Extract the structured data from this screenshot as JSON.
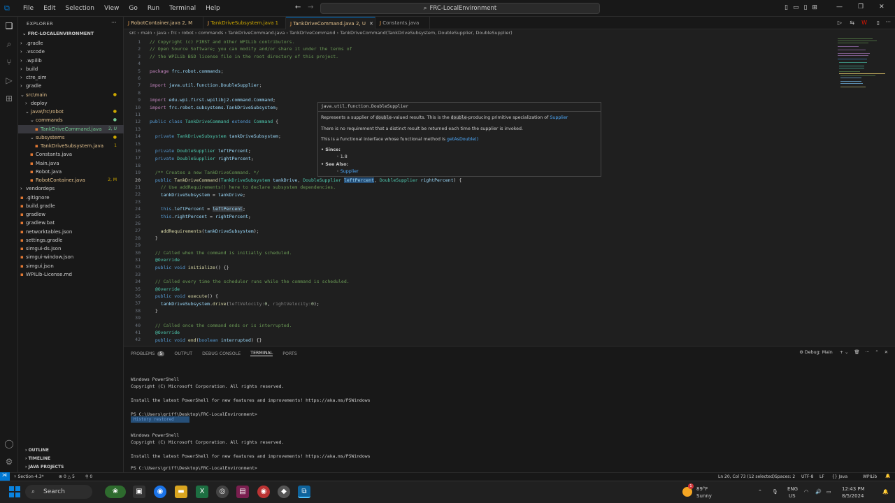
{
  "titlebar": {
    "menus": [
      "File",
      "Edit",
      "Selection",
      "View",
      "Go",
      "Run",
      "Terminal",
      "Help"
    ],
    "search": "FRC-LocalEnvironment"
  },
  "sidebar": {
    "title": "EXPLORER",
    "root": "FRC-LOCALENVIRONMENT",
    "items": [
      {
        "label": ".gradle",
        "badge": "",
        "indent": 1
      },
      {
        "label": ".vscode",
        "badge": "",
        "indent": 1
      },
      {
        "label": ".wpilib",
        "badge": "",
        "indent": 1
      },
      {
        "label": "build",
        "badge": "",
        "indent": 1
      },
      {
        "label": "ctre_sim",
        "badge": "",
        "indent": 1
      },
      {
        "label": "gradle",
        "badge": "",
        "indent": 1
      },
      {
        "label": "src\\main",
        "badge": "",
        "indent": 1
      },
      {
        "label": "deploy",
        "badge": "",
        "indent": 2
      },
      {
        "label": "java\\frc\\robot",
        "badge": "",
        "indent": 2
      },
      {
        "label": "commands",
        "badge": "",
        "indent": 3
      },
      {
        "label": "TankDriveCommand.java",
        "badge": "2, U",
        "indent": 4
      },
      {
        "label": "subsystems",
        "badge": "",
        "indent": 3
      },
      {
        "label": "TankDriveSubsystem.java",
        "badge": "1",
        "indent": 4
      },
      {
        "label": "Constants.java",
        "badge": "",
        "indent": 3
      },
      {
        "label": "Main.java",
        "badge": "",
        "indent": 3
      },
      {
        "label": "Robot.java",
        "badge": "",
        "indent": 3
      },
      {
        "label": "RobotContainer.java",
        "badge": "2, M",
        "indent": 3
      },
      {
        "label": "vendordeps",
        "badge": "",
        "indent": 1
      },
      {
        "label": ".gitignore",
        "badge": "",
        "indent": 1
      },
      {
        "label": "build.gradle",
        "badge": "",
        "indent": 1
      },
      {
        "label": "gradlew",
        "badge": "",
        "indent": 1
      },
      {
        "label": "gradlew.bat",
        "badge": "",
        "indent": 1
      },
      {
        "label": "networktables.json",
        "badge": "",
        "indent": 1
      },
      {
        "label": "settings.gradle",
        "badge": "",
        "indent": 1
      },
      {
        "label": "simgui-ds.json",
        "badge": "",
        "indent": 1
      },
      {
        "label": "simgui-window.json",
        "badge": "",
        "indent": 1
      },
      {
        "label": "simgui.json",
        "badge": "",
        "indent": 1
      },
      {
        "label": "WPILib-License.md",
        "badge": "",
        "indent": 1
      }
    ],
    "sections": [
      "OUTLINE",
      "TIMELINE",
      "JAVA PROJECTS"
    ]
  },
  "tabs": [
    {
      "label": "RobotContainer.java 2, M",
      "active": false
    },
    {
      "label": "TankDriveSubsystem.java 1",
      "active": false
    },
    {
      "label": "TankDriveCommand.java 2, U",
      "active": true
    },
    {
      "label": "Constants.java",
      "active": false
    }
  ],
  "breadcrumb": "src › main › java › frc › robot › commands › TankDriveCommand.java › TankDriveCommand › TankDriveCommand(TankDriveSubsystem, DoubleSupplier, DoubleSupplier)",
  "editor": {
    "lines": [
      "1",
      "2",
      "3",
      "4",
      "5",
      "6",
      "7",
      "8",
      "9",
      "10",
      "11",
      "12",
      "13",
      "14",
      "15",
      "16",
      "17",
      "18",
      "19",
      "20",
      "21",
      "22",
      "23",
      "24",
      "25",
      "26",
      "27",
      "28",
      "29",
      "30",
      "31",
      "32",
      "33",
      "34",
      "35",
      "36",
      "37",
      "38",
      "39",
      "40",
      "41",
      "42"
    ]
  },
  "hover": {
    "header": "java.util.function.DoubleSupplier",
    "l1a": "Represents a supplier of ",
    "l1b": "double",
    "l1c": "-valued results. This is the ",
    "l1d": "double",
    "l1e": "-producing primitive specialization of ",
    "l1f": "Supplier",
    "l2": "There is no requirement that a distinct result be returned each time the supplier is invoked.",
    "l3a": "This is a functional interface whose functional method is ",
    "l3b": "getAsDouble()",
    "since": "Since:",
    "sinceVal": "1.8",
    "seeAlso": "See Also:",
    "seeVal": "Supplier"
  },
  "panel": {
    "tabs": [
      "PROBLEMS",
      "5",
      "OUTPUT",
      "DEBUG CONSOLE",
      "TERMINAL",
      "PORTS"
    ],
    "right": "Debug: Main",
    "lines": [
      "Windows PowerShell",
      "Copyright (C) Microsoft Corporation. All rights reserved.",
      "Install the latest PowerShell for new features and improvements! https://aka.ms/PSWindows",
      "PS C:\\Users\\griff\\Desktop\\FRC-LocalEnvironment>",
      "History restored",
      "Windows PowerShell",
      "Copyright (C) Microsoft Corporation. All rights reserved.",
      "Install the latest PowerShell for new features and improvements! https://aka.ms/PSWindows",
      "PS C:\\Users\\griff\\Desktop\\FRC-LocalEnvironment>"
    ]
  },
  "statusbar": {
    "left": "Section-4.3*",
    "errors": "0 △ 5",
    "ports": "0",
    "right": [
      "Ln 20, Col 73 (12 selected)",
      "Spaces: 2",
      "UTF-8",
      "LF",
      "{} Java",
      "WPILib"
    ]
  },
  "taskbar": {
    "search": "Search",
    "weather_temp": "89°F",
    "weather_desc": "Sunny",
    "lang1": "ENG",
    "lang2": "US",
    "time": "12:43 PM",
    "date": "8/5/2024",
    "notif": "1"
  }
}
